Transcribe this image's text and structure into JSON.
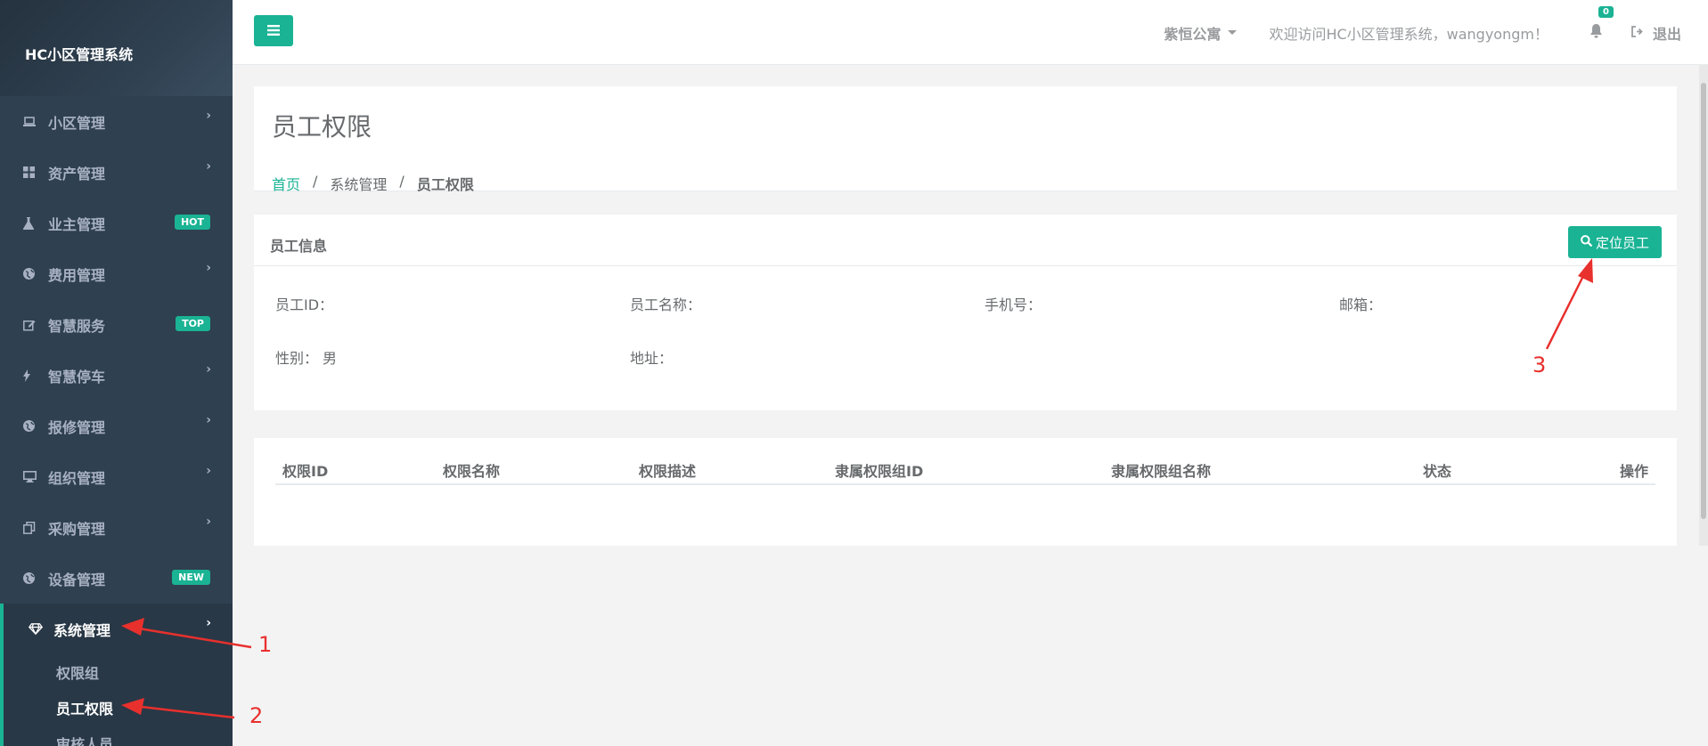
{
  "app": {
    "title": "HC小区管理系统"
  },
  "sidebar": {
    "items": [
      {
        "label": "小区管理",
        "icon": "laptop-icon",
        "badge": ""
      },
      {
        "label": "资产管理",
        "icon": "grid-icon",
        "badge": ""
      },
      {
        "label": "业主管理",
        "icon": "flask-icon",
        "badge": "HOT"
      },
      {
        "label": "费用管理",
        "icon": "globe-icon",
        "badge": ""
      },
      {
        "label": "智慧服务",
        "icon": "edit-icon",
        "badge": "TOP"
      },
      {
        "label": "智慧停车",
        "icon": "bolt-icon",
        "badge": ""
      },
      {
        "label": "报修管理",
        "icon": "globe-icon",
        "badge": ""
      },
      {
        "label": "组织管理",
        "icon": "desktop-icon",
        "badge": ""
      },
      {
        "label": "采购管理",
        "icon": "copy-icon",
        "badge": ""
      },
      {
        "label": "设备管理",
        "icon": "globe-icon",
        "badge": "NEW"
      },
      {
        "label": "系统管理",
        "icon": "diamond-icon",
        "badge": ""
      }
    ],
    "submenu": [
      "权限组",
      "员工权限",
      "审核人员"
    ]
  },
  "topbar": {
    "community": "紫恒公寓",
    "welcome": "欢迎访问HC小区管理系统，wangyongm！",
    "notification_count": "0",
    "logout": "退出"
  },
  "page": {
    "title": "员工权限",
    "breadcrumb": {
      "home": "首页",
      "level2": "系统管理",
      "current": "员工权限"
    }
  },
  "staff_info": {
    "title": "员工信息",
    "locate_button": "定位员工",
    "fields": {
      "id_label": "员工ID：",
      "name_label": "员工名称：",
      "phone_label": "手机号：",
      "email_label": "邮箱：",
      "gender_label": "性别：",
      "gender_value": "男",
      "address_label": "地址："
    }
  },
  "table": {
    "columns": [
      "权限ID",
      "权限名称",
      "权限描述",
      "隶属权限组ID",
      "隶属权限组名称",
      "状态",
      "操作"
    ]
  },
  "annotations": [
    "1",
    "2",
    "3"
  ],
  "colors": {
    "accent": "#1ab394",
    "sidebar": "#2f4050",
    "annotation": "#e8302d"
  }
}
